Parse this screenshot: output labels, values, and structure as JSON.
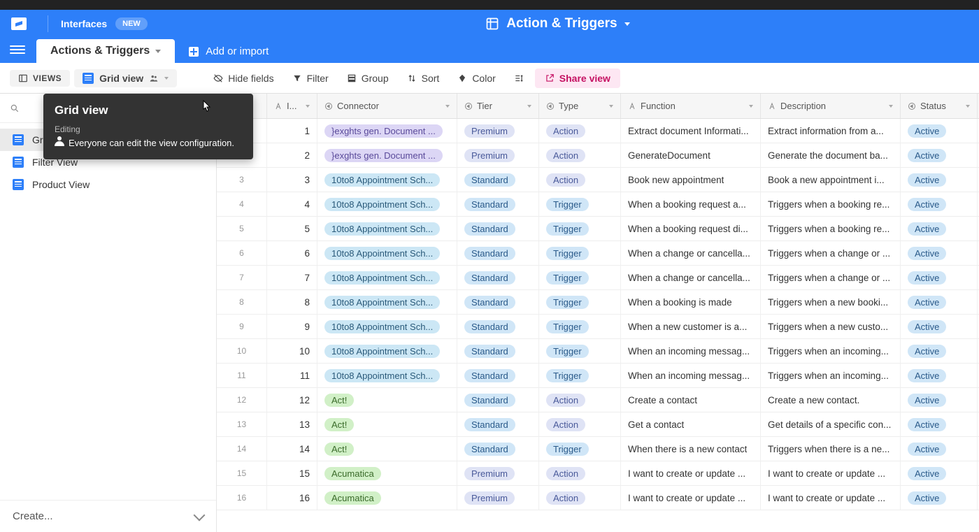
{
  "browser": {
    "url_fragment": "airtable.com/app..."
  },
  "header": {
    "interfaces": "Interfaces",
    "new_badge": "NEW",
    "base_title": "Action & Triggers"
  },
  "tables": {
    "active_tab": "Actions & Triggers",
    "add_import": "Add or import"
  },
  "toolbar": {
    "views_btn": "VIEWS",
    "grid_view": "Grid view",
    "hide_fields": "Hide fields",
    "filter": "Filter",
    "group": "Group",
    "sort": "Sort",
    "color": "Color",
    "share_view": "Share view"
  },
  "sidebar": {
    "views": [
      {
        "label": "Grid view",
        "selected": true
      },
      {
        "label": "Filter View",
        "selected": false
      },
      {
        "label": "Product View",
        "selected": false
      }
    ],
    "create_label": "Create..."
  },
  "tooltip": {
    "title": "Grid view",
    "editing_label": "Editing",
    "desc": "Everyone can edit the view configuration."
  },
  "columns": {
    "i": "I...",
    "connector": "Connector",
    "tier": "Tier",
    "type": "Type",
    "function": "Function",
    "description": "Description",
    "status": "Status"
  },
  "pill_colors": {
    "connector": {
      "default": "cyan",
      "Act!": "green",
      "Acumatica": "green",
      "}exghts gen. Document ...": "purple"
    },
    "type": {
      "Action": "lav",
      "Trigger": "blue"
    },
    "tier": {
      "Premium": "lav",
      "Standard": "blue"
    },
    "status": {
      "Active": "blue"
    }
  },
  "rows": [
    {
      "rownum": "",
      "i": "1",
      "connector": "}exghts gen. Document ...",
      "tier": "Premium",
      "type": "Action",
      "function": "Extract document Informati...",
      "description": "Extract information from a...",
      "status": "Active"
    },
    {
      "rownum": "",
      "i": "2",
      "connector": "}exghts gen. Document ...",
      "tier": "Premium",
      "type": "Action",
      "function": "GenerateDocument",
      "description": "Generate the document ba...",
      "status": "Active"
    },
    {
      "rownum": "3",
      "i": "3",
      "connector": "10to8 Appointment Sch...",
      "tier": "Standard",
      "type": "Action",
      "function": "Book new appointment",
      "description": "Book a new appointment i...",
      "status": "Active"
    },
    {
      "rownum": "4",
      "i": "4",
      "connector": "10to8 Appointment Sch...",
      "tier": "Standard",
      "type": "Trigger",
      "function": "When a booking request a...",
      "description": "Triggers when a booking re...",
      "status": "Active"
    },
    {
      "rownum": "5",
      "i": "5",
      "connector": "10to8 Appointment Sch...",
      "tier": "Standard",
      "type": "Trigger",
      "function": "When a booking request di...",
      "description": "Triggers when a booking re...",
      "status": "Active"
    },
    {
      "rownum": "6",
      "i": "6",
      "connector": "10to8 Appointment Sch...",
      "tier": "Standard",
      "type": "Trigger",
      "function": "When a change or cancella...",
      "description": "Triggers when a change or ...",
      "status": "Active"
    },
    {
      "rownum": "7",
      "i": "7",
      "connector": "10to8 Appointment Sch...",
      "tier": "Standard",
      "type": "Trigger",
      "function": "When a change or cancella...",
      "description": "Triggers when a change or ...",
      "status": "Active"
    },
    {
      "rownum": "8",
      "i": "8",
      "connector": "10to8 Appointment Sch...",
      "tier": "Standard",
      "type": "Trigger",
      "function": "When a booking is made",
      "description": "Triggers when a new booki...",
      "status": "Active"
    },
    {
      "rownum": "9",
      "i": "9",
      "connector": "10to8 Appointment Sch...",
      "tier": "Standard",
      "type": "Trigger",
      "function": "When a new customer is a...",
      "description": "Triggers when a new custo...",
      "status": "Active"
    },
    {
      "rownum": "10",
      "i": "10",
      "connector": "10to8 Appointment Sch...",
      "tier": "Standard",
      "type": "Trigger",
      "function": "When an incoming messag...",
      "description": "Triggers when an incoming...",
      "status": "Active"
    },
    {
      "rownum": "11",
      "i": "11",
      "connector": "10to8 Appointment Sch...",
      "tier": "Standard",
      "type": "Trigger",
      "function": "When an incoming messag...",
      "description": "Triggers when an incoming...",
      "status": "Active"
    },
    {
      "rownum": "12",
      "i": "12",
      "connector": "Act!",
      "tier": "Standard",
      "type": "Action",
      "function": "Create a contact",
      "description": "Create a new contact.",
      "status": "Active"
    },
    {
      "rownum": "13",
      "i": "13",
      "connector": "Act!",
      "tier": "Standard",
      "type": "Action",
      "function": "Get a contact",
      "description": "Get details of a specific con...",
      "status": "Active"
    },
    {
      "rownum": "14",
      "i": "14",
      "connector": "Act!",
      "tier": "Standard",
      "type": "Trigger",
      "function": "When there is a new contact",
      "description": "Triggers when there is a ne...",
      "status": "Active"
    },
    {
      "rownum": "15",
      "i": "15",
      "connector": "Acumatica",
      "tier": "Premium",
      "type": "Action",
      "function": "I want to create or update ...",
      "description": "I want to create or update ...",
      "status": "Active"
    },
    {
      "rownum": "16",
      "i": "16",
      "connector": "Acumatica",
      "tier": "Premium",
      "type": "Action",
      "function": "I want to create or update ...",
      "description": "I want to create or update ...",
      "status": "Active"
    }
  ]
}
